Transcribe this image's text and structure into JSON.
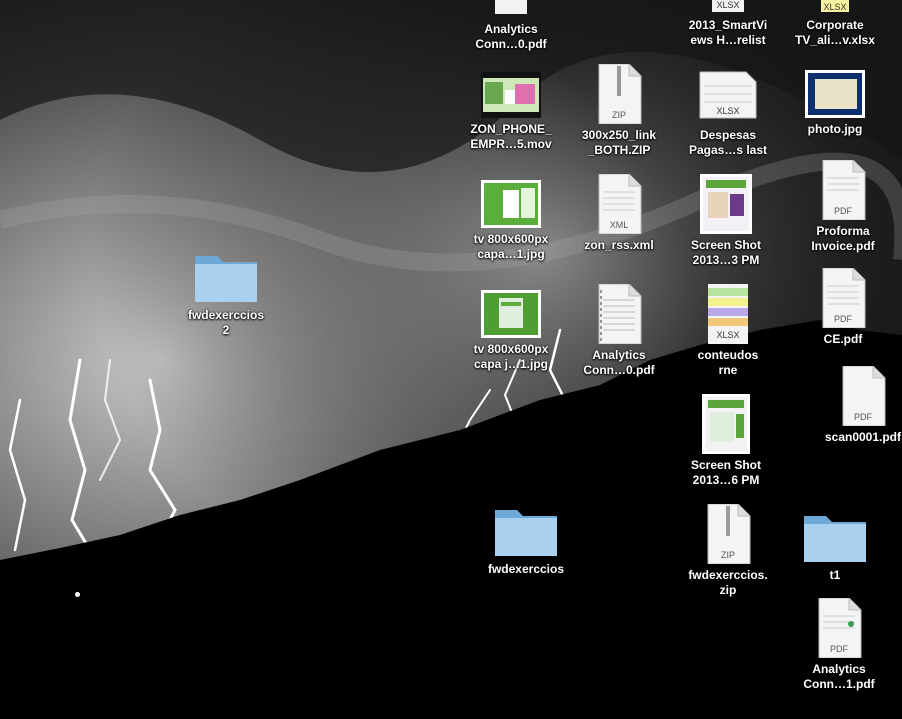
{
  "desktop": {
    "icons": [
      {
        "type": "pdf",
        "line1": "Analytics",
        "line2": "Conn…0.pdf",
        "cut": true
      },
      {
        "type": "xlsx",
        "line1": "2013_SmartVi",
        "line2": "ews H…relist",
        "cut": true
      },
      {
        "type": "xlsx-color",
        "line1": "Corporate",
        "line2": "TV_ali…v.xlsx",
        "cut": true
      },
      {
        "type": "video",
        "line1": "ZON_PHONE_",
        "line2": "EMPR…5.mov"
      },
      {
        "type": "zip",
        "badge": "ZIP",
        "line1": "300x250_link",
        "line2": "_BOTH.ZIP"
      },
      {
        "type": "xlsx",
        "badge": "XLSX",
        "line1": "Despesas",
        "line2": "Pagas…s last"
      },
      {
        "type": "photo",
        "line1": "photo.jpg",
        "line2": ""
      },
      {
        "type": "folder",
        "line1": "fwdexerccios",
        "line2": "2"
      },
      {
        "type": "image-green",
        "line1": "tv 800x600px",
        "line2": "capa…1.jpg"
      },
      {
        "type": "xml",
        "badge": "XML",
        "line1": "zon_rss.xml",
        "line2": ""
      },
      {
        "type": "screenshot",
        "line1": "Screen Shot",
        "line2": "2013…3 PM"
      },
      {
        "type": "pdf",
        "badge": "PDF",
        "line1": "Proforma",
        "line2": "Invoice.pdf"
      },
      {
        "type": "image-green2",
        "line1": "tv 800x600px",
        "line2": "capa j…1.jpg"
      },
      {
        "type": "pdf-doc",
        "line1": "Analytics",
        "line2": "Conn…0.pdf"
      },
      {
        "type": "xlsx-color",
        "badge": "XLSX",
        "line1": "conteudos",
        "line2": "rne"
      },
      {
        "type": "pdf",
        "badge": "PDF",
        "line1": "CE.pdf",
        "line2": ""
      },
      {
        "type": "pdf",
        "badge": "PDF",
        "line1": "scan0001.pdf",
        "line2": ""
      },
      {
        "type": "screenshot",
        "line1": "Screen Shot",
        "line2": "2013…6 PM"
      },
      {
        "type": "folder",
        "line1": "fwdexerccios",
        "line2": ""
      },
      {
        "type": "zip",
        "badge": "ZIP",
        "line1": "fwdexerccios.",
        "line2": "zip"
      },
      {
        "type": "folder",
        "line1": "t1",
        "line2": ""
      },
      {
        "type": "pdf",
        "badge": "PDF",
        "line1": "Analytics",
        "line2": "Conn…1.pdf"
      }
    ]
  }
}
